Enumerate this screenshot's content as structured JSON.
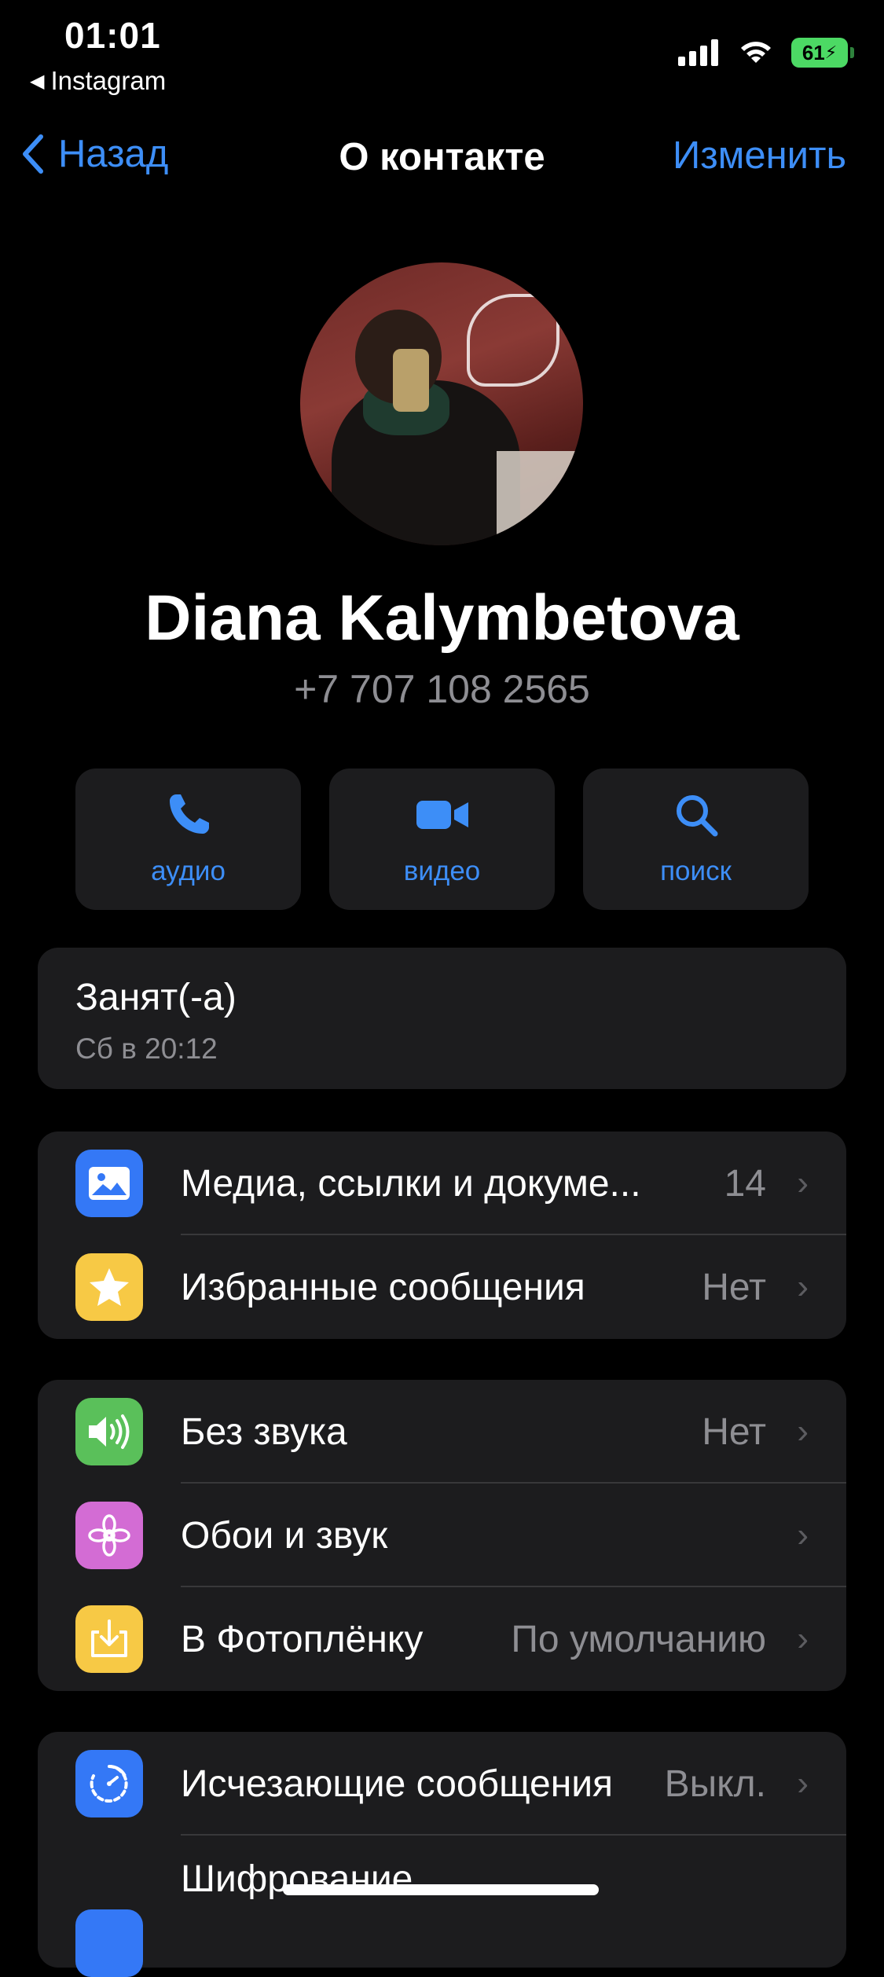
{
  "status_bar": {
    "time": "01:01",
    "back_app": "Instagram",
    "battery": "61"
  },
  "nav": {
    "back_label": "Назад",
    "title": "О контакте",
    "edit_label": "Изменить"
  },
  "contact": {
    "name": "Diana Kalymbetova",
    "phone": "+7 707 108 2565"
  },
  "actions": [
    {
      "label": "аудио",
      "icon": "phone-icon"
    },
    {
      "label": "видео",
      "icon": "video-icon"
    },
    {
      "label": "поиск",
      "icon": "search-icon"
    }
  ],
  "status": {
    "text": "Занят(-а)",
    "last_seen": "Сб в 20:12"
  },
  "group1": [
    {
      "label": "Медиа, ссылки и докуме...",
      "value": "14",
      "icon": "photo-icon",
      "color": "#3478f6"
    },
    {
      "label": "Избранные сообщения",
      "value": "Нет",
      "icon": "star-icon",
      "color": "#f7c945"
    }
  ],
  "group2": [
    {
      "label": "Без звука",
      "value": "Нет",
      "icon": "speaker-icon",
      "color": "#5ac05a"
    },
    {
      "label": "Обои и звук",
      "value": "",
      "icon": "flower-icon",
      "color": "#d36cd4"
    },
    {
      "label": "В Фотоплёнку",
      "value": "По умолчанию",
      "icon": "download-icon",
      "color": "#f7c945"
    }
  ],
  "group3": [
    {
      "label": "Исчезающие сообщения",
      "value": "Выкл.",
      "icon": "timer-icon",
      "color": "#3478f6"
    },
    {
      "label": "Шифрование",
      "value": "",
      "icon": "lock-icon",
      "color": "#3478f6"
    }
  ],
  "colors": {
    "accent": "#3d8ef7",
    "background": "#000000",
    "card": "#1c1c1e",
    "secondary_text": "#8e8e93"
  }
}
